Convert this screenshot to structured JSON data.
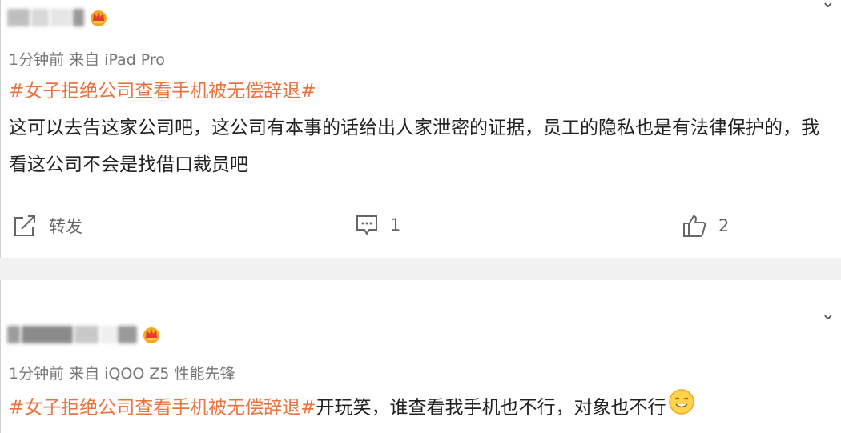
{
  "post1": {
    "meta": "1分钟前  来自 iPad Pro",
    "hashtag": "#女子拒绝公司查看手机被无偿辞退#",
    "content": "这可以去告这家公司吧，这公司有本事的话给出人家泄密的证据，员工的隐私也是有法律保护的，我看这公司不会是找借口裁员吧",
    "actions": {
      "repost_label": "转发",
      "comment_count": "1",
      "like_count": "2"
    }
  },
  "post2": {
    "meta": "1分钟前  来自 iQOO Z5 性能先锋",
    "hashtag": "#女子拒绝公司查看手机被无偿辞退#",
    "content": "开玩笑，谁查看我手机也不行，对象也不行"
  },
  "icons": {
    "chevron": "chevron-down-icon",
    "crown": "crown-badge-icon",
    "repost": "repost-icon",
    "comment": "comment-icon",
    "like": "thumbs-up-icon",
    "emoji": "smile-emoji-icon"
  },
  "colors": {
    "hashtag": "#eb7340",
    "meta": "#777777",
    "separator": "#f1f1f1"
  }
}
